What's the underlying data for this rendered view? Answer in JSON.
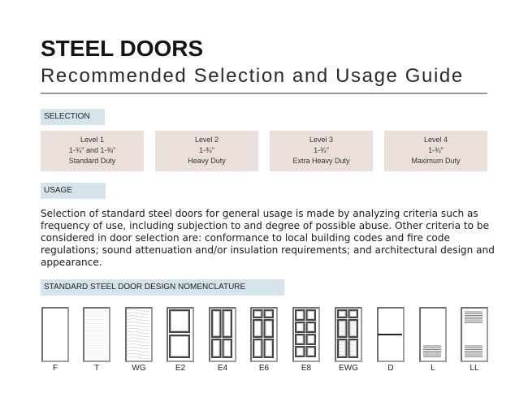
{
  "header": {
    "title": "STEEL DOORS",
    "subtitle": "Recommended Selection and Usage Guide"
  },
  "selection": {
    "tag": "SELECTION",
    "levels": [
      {
        "level": "Level 1",
        "thickness": "1-¾\" and 1-⅜\"",
        "duty": "Standard Duty"
      },
      {
        "level": "Level 2",
        "thickness": "1-¾\"",
        "duty": "Heavy Duty"
      },
      {
        "level": "Level 3",
        "thickness": "1-¾\"",
        "duty": "Extra Heavy Duty"
      },
      {
        "level": "Level 4",
        "thickness": "1-¾\"",
        "duty": "Maximum Duty"
      }
    ]
  },
  "usage": {
    "tag": "USAGE",
    "text": "Selection of standard steel doors for general usage is made by analyzing criteria such as frequency of use, including subjection to and degree of possible abuse. Other criteria to be considered in door selection are: conformance to local building codes and fire code regulations; sound attenuation and/or insulation requirements; and architectural design and appearance."
  },
  "nomenclature": {
    "tag": "STANDARD STEEL DOOR DESIGN NOMENCLATURE",
    "doors": [
      {
        "code": "F",
        "type": "flush"
      },
      {
        "code": "T",
        "type": "textured"
      },
      {
        "code": "WG",
        "type": "woodgrain"
      },
      {
        "code": "E2",
        "type": "2-panel"
      },
      {
        "code": "E4",
        "type": "4-panel"
      },
      {
        "code": "E6",
        "type": "6-panel"
      },
      {
        "code": "E8",
        "type": "8-panel"
      },
      {
        "code": "EWG",
        "type": "6-panel-woodgrain"
      },
      {
        "code": "D",
        "type": "dutch"
      },
      {
        "code": "L",
        "type": "louver-bottom"
      },
      {
        "code": "LL",
        "type": "louver-top-bottom"
      }
    ]
  }
}
